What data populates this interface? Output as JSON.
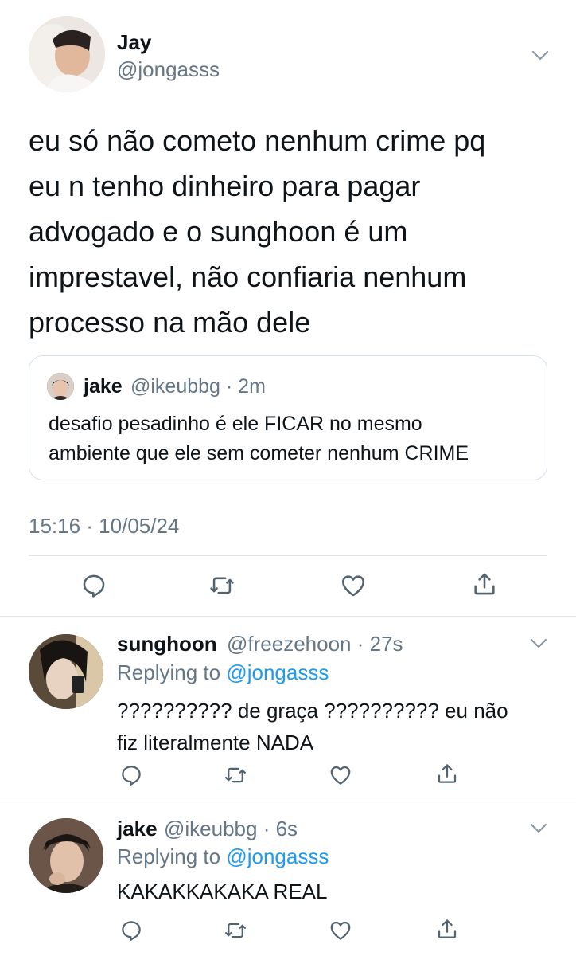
{
  "main_tweet": {
    "author_name": "Jay",
    "author_handle": "@jongasss",
    "text_lines": [
      "eu só não cometo nenhum crime pq",
      "eu n tenho dinheiro para pagar",
      "advogado e o sunghoon é um",
      "imprestavel, não confiaria nenhum",
      "processo na mão dele"
    ],
    "timestamp": "15:16 · 10/05/24",
    "quoted": {
      "author_name": "jake",
      "author_handle": "@ikeubbg",
      "time": "· 2m",
      "text_lines": [
        "desafio pesadinho é ele FICAR no mesmo",
        "ambiente que ele sem cometer nenhum CRIME"
      ]
    }
  },
  "replies": [
    {
      "author_name": "sunghoon",
      "author_handle": "@freezehoon",
      "time": "· 27s",
      "replying_prefix": "Replying to",
      "replying_to": "@jongasss",
      "text_lines": [
        "?????????? de graça ?????????? eu não",
        "fiz literalmente NADA"
      ]
    },
    {
      "author_name": "jake",
      "author_handle": "@ikeubbg",
      "time": "· 6s",
      "replying_prefix": "Replying to",
      "replying_to": "@jongasss",
      "text_lines": [
        "KAKAKKAKAKA REAL"
      ]
    }
  ],
  "icons": {
    "more": "chevron-down-icon",
    "reply": "reply-icon",
    "retweet": "retweet-icon",
    "like": "heart-icon",
    "share": "share-icon"
  },
  "colors": {
    "accent": "#1d9bf0",
    "secondary_text": "#657786",
    "divider": "#e1e8ed"
  }
}
